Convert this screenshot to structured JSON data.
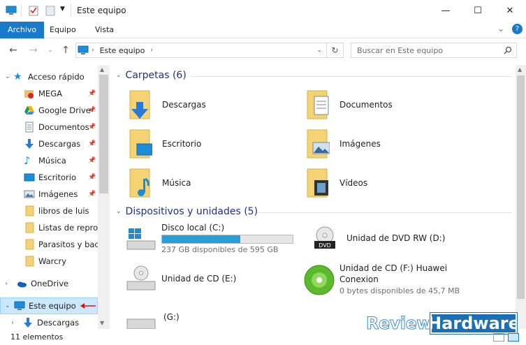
{
  "window": {
    "title": "Este equipo",
    "controls": {
      "minimize": "—",
      "maximize": "☐",
      "close": "✕"
    }
  },
  "ribbon": {
    "tabs": [
      "Archivo",
      "Equipo",
      "Vista"
    ],
    "expand": "⌄",
    "help": "?"
  },
  "address": {
    "crumb": "Este equipo",
    "search_placeholder": "Buscar en Este equipo"
  },
  "nav": {
    "quick_access": "Acceso rápido",
    "items": [
      {
        "label": "MEGA",
        "icon": "mega-icon",
        "pinned": true
      },
      {
        "label": "Google Drive",
        "icon": "google-drive-icon",
        "pinned": true
      },
      {
        "label": "Documentos",
        "icon": "documents-icon",
        "pinned": true
      },
      {
        "label": "Descargas",
        "icon": "download-arrow-icon",
        "pinned": true
      },
      {
        "label": "Música",
        "icon": "music-note-icon",
        "pinned": true
      },
      {
        "label": "Escritorio",
        "icon": "desktop-icon",
        "pinned": true
      },
      {
        "label": "Imágenes",
        "icon": "pictures-icon",
        "pinned": true
      },
      {
        "label": "libros de luis",
        "icon": "folder-icon",
        "pinned": false
      },
      {
        "label": "Listas de reprodu",
        "icon": "folder-icon",
        "pinned": false
      },
      {
        "label": "Parasitos y bacte",
        "icon": "folder-icon",
        "pinned": false
      },
      {
        "label": "Warcry",
        "icon": "folder-icon",
        "pinned": false
      }
    ],
    "onedrive": "OneDrive",
    "this_pc": "Este equipo",
    "sub_item": "Descargas"
  },
  "content": {
    "folders_header": "Carpetas (6)",
    "folders": [
      {
        "label": "Descargas",
        "icon": "downloads-folder-icon"
      },
      {
        "label": "Documentos",
        "icon": "documents-folder-icon"
      },
      {
        "label": "Escritorio",
        "icon": "desktop-folder-icon"
      },
      {
        "label": "Imágenes",
        "icon": "pictures-folder-icon"
      },
      {
        "label": "Música",
        "icon": "music-folder-icon"
      },
      {
        "label": "Vídeos",
        "icon": "videos-folder-icon"
      }
    ],
    "devices_header": "Dispositivos y unidades (5)",
    "devices": [
      {
        "label": "Disco local (C:)",
        "free": "237 GB disponibles de 595 GB",
        "used_fraction": 0.6
      },
      {
        "label": "Unidad de DVD RW (D:)"
      },
      {
        "label": "Unidad de CD (E:)"
      },
      {
        "label": "Unidad de CD (F:) Huawei Conexion",
        "free": "0 bytes disponibles de 45,7 MB"
      },
      {
        "label": "(G:)"
      }
    ]
  },
  "status": {
    "count": "11 elementos"
  },
  "watermark": {
    "left": "Review",
    "right": "Hardware"
  },
  "colors": {
    "accent": "#1979ca",
    "header": "#1e3287",
    "selection": "#cce8ff",
    "progress": "#26a0da"
  }
}
